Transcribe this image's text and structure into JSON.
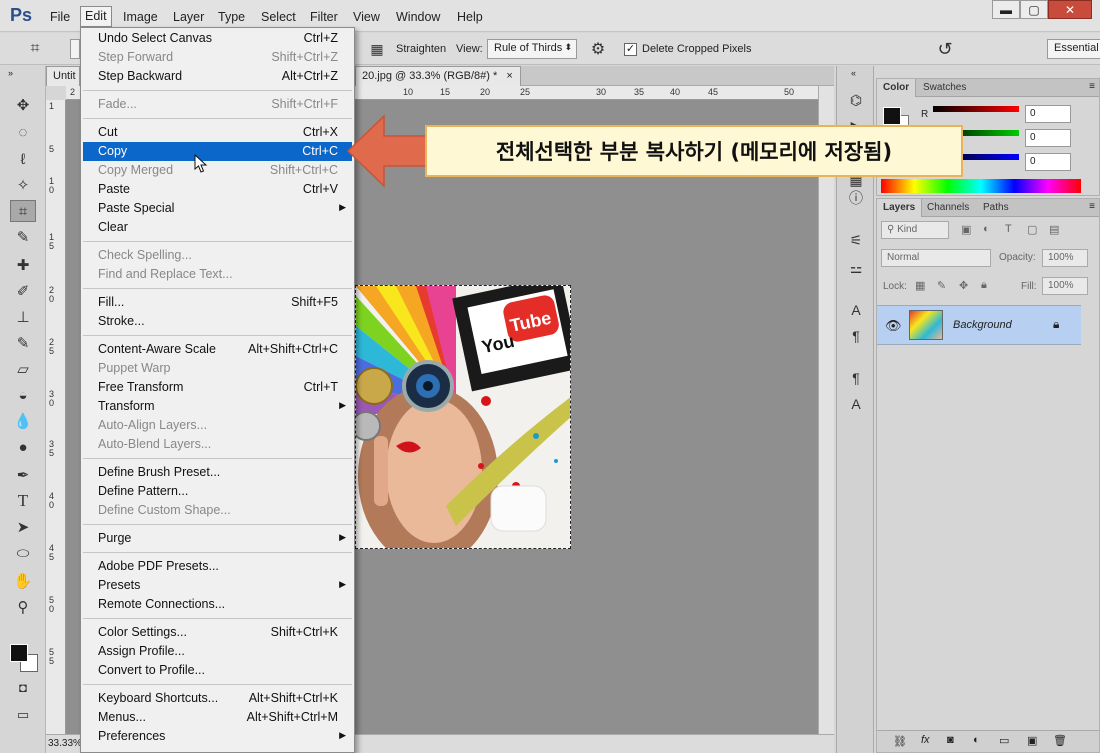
{
  "app": {
    "logo": "Ps"
  },
  "menubar": [
    "File",
    "Edit",
    "Image",
    "Layer",
    "Type",
    "Select",
    "Filter",
    "View",
    "Window",
    "Help"
  ],
  "window_buttons": {
    "minimize": "▬",
    "maximize": "▢",
    "close": "✕"
  },
  "options": {
    "straighten": "Straighten",
    "view_label": "View:",
    "view_value": "Rule of Thirds",
    "delete_cropped": "Delete Cropped Pixels",
    "workspace": "Essential"
  },
  "document": {
    "tab1": "Untit",
    "tab2": "20.jpg @ 33.3% (RGB/8#) *",
    "tab_close": "×",
    "zoom": "33.33%"
  },
  "ruler_h": [
    "2",
    "10",
    "15",
    "20",
    "25",
    "30",
    "35",
    "40",
    "45",
    "50"
  ],
  "ruler_v": [
    "1",
    "5",
    "1 0",
    "1 5",
    "2 0",
    "2 5",
    "3 0",
    "3 5",
    "4 0",
    "4 5",
    "5 0",
    "5 5"
  ],
  "image": {
    "youtube_you": "You",
    "youtube_tube": "Tube"
  },
  "color_panel": {
    "tabs": [
      "Color",
      "Swatches"
    ],
    "label_r": "R",
    "r": "0",
    "g": "0",
    "b": "0"
  },
  "layers_panel": {
    "tabs": [
      "Layers",
      "Channels",
      "Paths"
    ],
    "kind": "Kind",
    "blend": "Normal",
    "opacity_label": "Opacity:",
    "opacity": "100%",
    "lock_label": "Lock:",
    "fill_label": "Fill:",
    "fill": "100%",
    "layer_name": "Background"
  },
  "edit_menu": {
    "items": [
      {
        "label": "Undo Select Canvas",
        "shortcut": "Ctrl+Z",
        "disabled": false
      },
      {
        "label": "Step Forward",
        "shortcut": "Shift+Ctrl+Z",
        "disabled": true
      },
      {
        "label": "Step Backward",
        "shortcut": "Alt+Ctrl+Z",
        "disabled": false
      },
      {
        "sep": true
      },
      {
        "label": "Fade...",
        "shortcut": "Shift+Ctrl+F",
        "disabled": true
      },
      {
        "sep": true
      },
      {
        "label": "Cut",
        "shortcut": "Ctrl+X",
        "disabled": false
      },
      {
        "label": "Copy",
        "shortcut": "Ctrl+C",
        "disabled": false,
        "highlighted": true
      },
      {
        "label": "Copy Merged",
        "shortcut": "Shift+Ctrl+C",
        "disabled": true
      },
      {
        "label": "Paste",
        "shortcut": "Ctrl+V",
        "disabled": false
      },
      {
        "label": "Paste Special",
        "shortcut": "",
        "submenu": true,
        "disabled": false
      },
      {
        "label": "Clear",
        "shortcut": "",
        "disabled": false
      },
      {
        "sep": true
      },
      {
        "label": "Check Spelling...",
        "shortcut": "",
        "disabled": true
      },
      {
        "label": "Find and Replace Text...",
        "shortcut": "",
        "disabled": true
      },
      {
        "sep": true
      },
      {
        "label": "Fill...",
        "shortcut": "Shift+F5",
        "disabled": false
      },
      {
        "label": "Stroke...",
        "shortcut": "",
        "disabled": false
      },
      {
        "sep": true
      },
      {
        "label": "Content-Aware Scale",
        "shortcut": "Alt+Shift+Ctrl+C",
        "disabled": false
      },
      {
        "label": "Puppet Warp",
        "shortcut": "",
        "disabled": true
      },
      {
        "label": "Free Transform",
        "shortcut": "Ctrl+T",
        "disabled": false
      },
      {
        "label": "Transform",
        "shortcut": "",
        "submenu": true,
        "disabled": false
      },
      {
        "label": "Auto-Align Layers...",
        "shortcut": "",
        "disabled": true
      },
      {
        "label": "Auto-Blend Layers...",
        "shortcut": "",
        "disabled": true
      },
      {
        "sep": true
      },
      {
        "label": "Define Brush Preset...",
        "shortcut": "",
        "disabled": false
      },
      {
        "label": "Define Pattern...",
        "shortcut": "",
        "disabled": false
      },
      {
        "label": "Define Custom Shape...",
        "shortcut": "",
        "disabled": true
      },
      {
        "sep": true
      },
      {
        "label": "Purge",
        "shortcut": "",
        "submenu": true,
        "disabled": false
      },
      {
        "sep": true
      },
      {
        "label": "Adobe PDF Presets...",
        "shortcut": "",
        "disabled": false
      },
      {
        "label": "Presets",
        "shortcut": "",
        "submenu": true,
        "disabled": false
      },
      {
        "label": "Remote Connections...",
        "shortcut": "",
        "disabled": false
      },
      {
        "sep": true
      },
      {
        "label": "Color Settings...",
        "shortcut": "Shift+Ctrl+K",
        "disabled": false
      },
      {
        "label": "Assign Profile...",
        "shortcut": "",
        "disabled": false
      },
      {
        "label": "Convert to Profile...",
        "shortcut": "",
        "disabled": false
      },
      {
        "sep": true
      },
      {
        "label": "Keyboard Shortcuts...",
        "shortcut": "Alt+Shift+Ctrl+K",
        "disabled": false
      },
      {
        "label": "Menus...",
        "shortcut": "Alt+Shift+Ctrl+M",
        "disabled": false
      },
      {
        "label": "Preferences",
        "shortcut": "",
        "submenu": true,
        "disabled": false
      }
    ]
  },
  "callout": {
    "text": "전체선택한 부분 복사하기 (메모리에 저장됨)"
  },
  "colors": {
    "highlight": "#0b67c9",
    "callout_bg": "#fff8d4",
    "callout_border": "#e8b35a",
    "arrow": "#e06a4c",
    "layer_selected": "#b7cff0"
  }
}
